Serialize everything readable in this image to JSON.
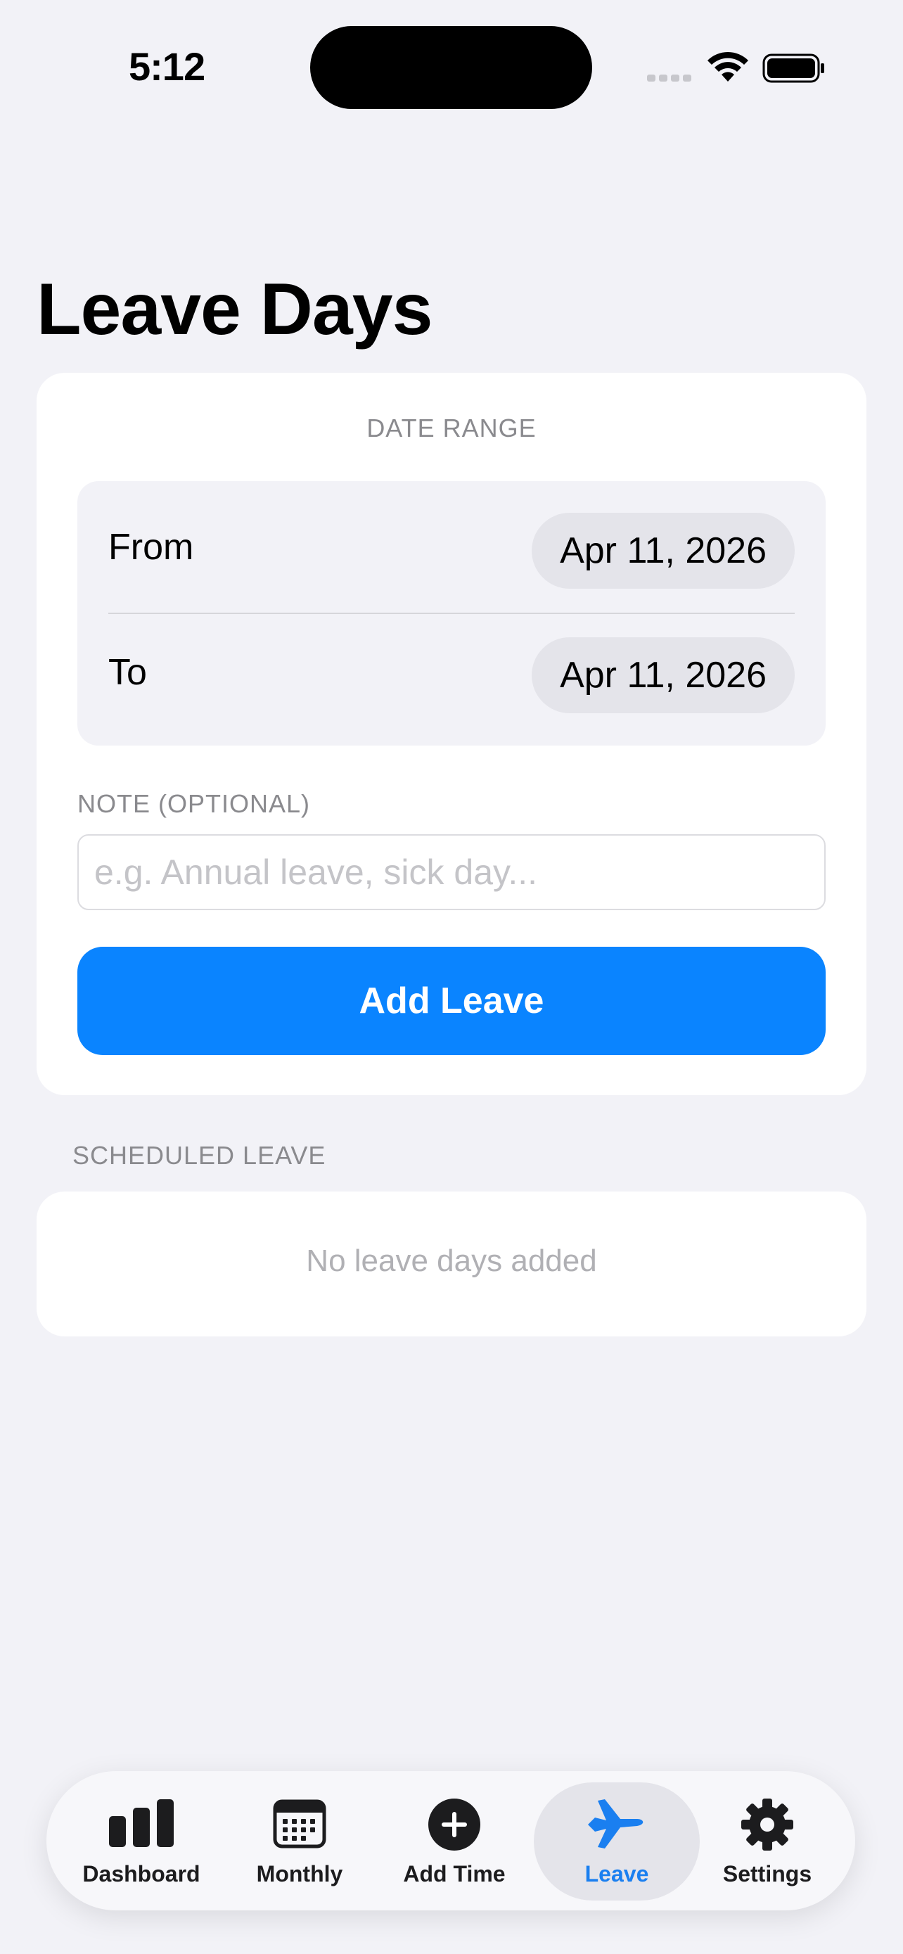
{
  "status_bar": {
    "time": "5:12",
    "icons": [
      "signal-icon",
      "wifi-icon",
      "battery-icon"
    ]
  },
  "page": {
    "title": "Leave Days"
  },
  "date_range": {
    "header": "DATE RANGE",
    "from_label": "From",
    "from_value": "Apr 11, 2026",
    "to_label": "To",
    "to_value": "Apr 11, 2026"
  },
  "note": {
    "label": "NOTE (OPTIONAL)",
    "value": "",
    "placeholder": "e.g. Annual leave, sick day..."
  },
  "add_button": {
    "label": "Add Leave",
    "color": "#0a84ff"
  },
  "scheduled": {
    "header": "SCHEDULED LEAVE",
    "empty_text": "No leave days added"
  },
  "tab_bar": {
    "active_color": "#1a7ff0",
    "tabs": [
      {
        "label": "Dashboard",
        "icon": "chart-bar-icon",
        "active": false
      },
      {
        "label": "Monthly",
        "icon": "calendar-icon",
        "active": false
      },
      {
        "label": "Add Time",
        "icon": "plus-circle-icon",
        "active": false
      },
      {
        "label": "Leave",
        "icon": "airplane-icon",
        "active": true
      },
      {
        "label": "Settings",
        "icon": "gear-icon",
        "active": false
      }
    ]
  }
}
